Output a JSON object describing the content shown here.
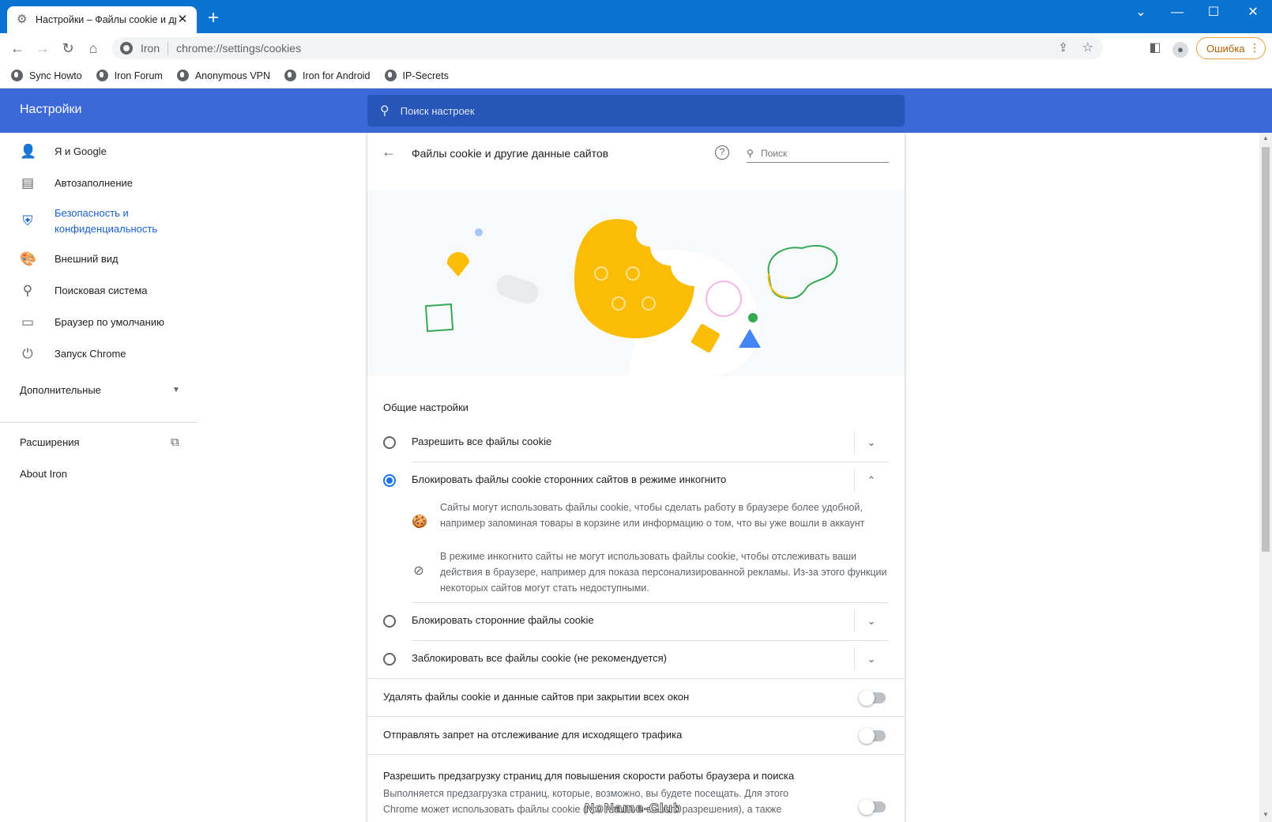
{
  "browser": {
    "tab_title": "Настройки – Файлы cookie и др",
    "tab_icon": "gear-icon",
    "site_name": "Iron",
    "url": "chrome://settings/cookies",
    "error_label": "Ошибка",
    "bookmarks": [
      {
        "label": "Sync Howto",
        "icon": "globe-icon"
      },
      {
        "label": "Iron Forum",
        "icon": "globe-icon"
      },
      {
        "label": "Anonymous VPN",
        "icon": "globe-icon"
      },
      {
        "label": "Iron for Android",
        "icon": "globe-icon"
      },
      {
        "label": "IP-Secrets",
        "icon": "globe-icon"
      }
    ]
  },
  "header": {
    "title": "Настройки",
    "search_placeholder": "Поиск настроек"
  },
  "sidebar": {
    "items": [
      {
        "label": "Я и Google",
        "icon": "person-icon"
      },
      {
        "label": "Автозаполнение",
        "icon": "clipboard-icon"
      },
      {
        "label": "Безопасность и конфиденциальность",
        "icon": "shield-icon"
      },
      {
        "label": "Внешний вид",
        "icon": "palette-icon"
      },
      {
        "label": "Поисковая система",
        "icon": "search-icon"
      },
      {
        "label": "Браузер по умолчанию",
        "icon": "browser-icon"
      },
      {
        "label": "Запуск Chrome",
        "icon": "power-icon"
      }
    ],
    "advanced_label": "Дополнительные",
    "extensions_label": "Расширения",
    "about_label": "About Iron"
  },
  "page": {
    "title": "Файлы cookie и другие данные сайтов",
    "search_placeholder": "Поиск",
    "section_label": "Общие настройки",
    "options": [
      {
        "label": "Разрешить все файлы cookie",
        "checked": false,
        "expanded": false
      },
      {
        "label": "Блокировать файлы cookie сторонних сайтов в режиме инкогнито",
        "checked": true,
        "expanded": true
      },
      {
        "label": "Блокировать сторонние файлы cookie",
        "checked": false,
        "expanded": false
      },
      {
        "label": "Заблокировать все файлы cookie (не рекомендуется)",
        "checked": false,
        "expanded": false
      }
    ],
    "details": [
      {
        "icon": "cookie-icon",
        "text": "Сайты могут использовать файлы cookie, чтобы сделать работу в браузере более удобной, например запоминая товары в корзине или информацию о том, что вы уже вошли в аккаунт"
      },
      {
        "icon": "block-icon",
        "text": "В режиме инкогнито сайты не могут использовать файлы cookie, чтобы отслеживать ваши действия в браузере, например для показа персонализированной рекламы. Из-за этого функции некоторых сайтов могут стать недоступными."
      }
    ],
    "toggles": [
      {
        "label": "Удалять файлы cookie и данные сайтов при закрытии всех окон",
        "on": false
      },
      {
        "label": "Отправлять запрет на отслеживание для исходящего трафика",
        "on": false
      }
    ],
    "preload": {
      "label": "Разрешить предзагрузку страниц для повышения скорости работы браузера и поиска",
      "description": "Выполняется предзагрузка страниц, которые, возможно, вы будете посещать. Для этого Chrome может использовать файлы cookie (при наличии вашего разрешения), а также",
      "on": false
    }
  },
  "watermark": "NoName-Club",
  "colors": {
    "accent": "#1a73e8",
    "header_bg": "#3b6ad8",
    "titlebar_bg": "#0a73d2",
    "cookie_yellow": "#fbbc04"
  }
}
